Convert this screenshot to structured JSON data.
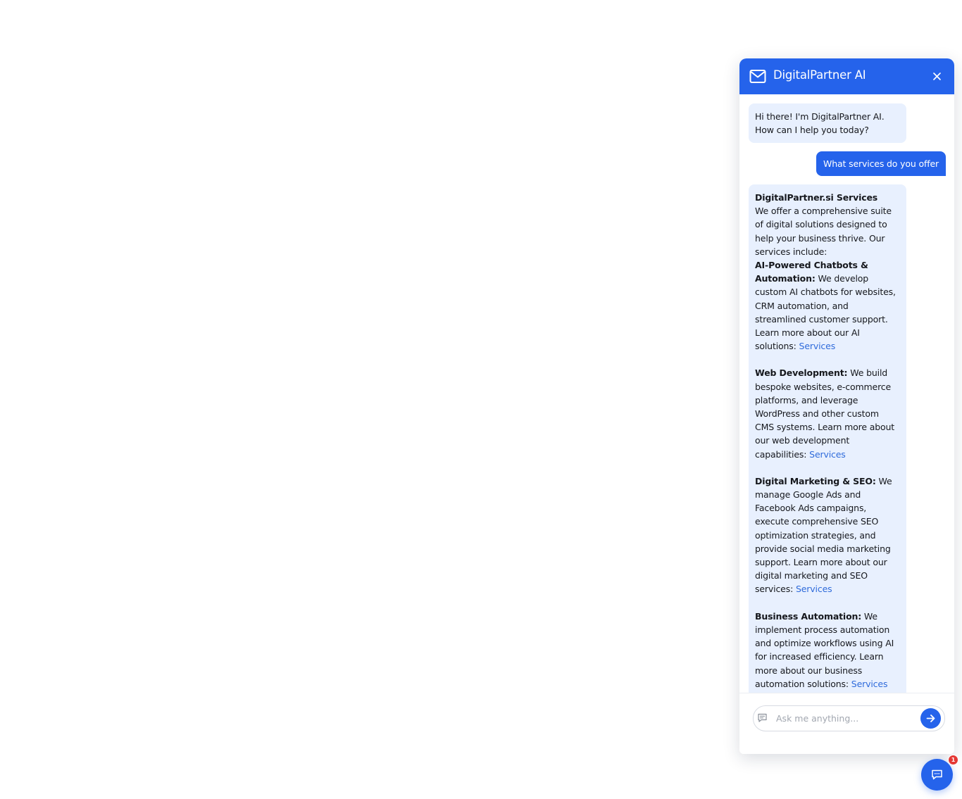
{
  "header": {
    "title": "DigitalPartner AI",
    "icon": "mail-icon",
    "close_icon": "close-icon",
    "color": "#2563eb"
  },
  "messages": [
    {
      "role": "bot",
      "text": "Hi there! I'm DigitalPartner AI. How can I help you today?"
    },
    {
      "role": "user",
      "text": "What services do you offer"
    },
    {
      "role": "bot",
      "heading": "DigitalPartner.si Services",
      "intro": "We offer a comprehensive suite of digital solutions designed to help your business thrive. Our services include:",
      "sections": [
        {
          "title": "AI-Powered Chatbots & Automation:",
          "body": " We develop custom AI chatbots for websites, CRM automation, and streamlined customer support. Learn more about our AI solutions: ",
          "link": "Services"
        },
        {
          "title": "Web Development:",
          "body": " We build bespoke websites, e-commerce platforms, and leverage WordPress and other custom CMS systems. Learn more about our web development capabilities: ",
          "link": "Services"
        },
        {
          "title": "Digital Marketing & SEO:",
          "body": " We manage Google Ads and Facebook Ads campaigns, execute comprehensive SEO optimization strategies, and provide social media marketing support. Learn more about our digital marketing and SEO services: ",
          "link": "Services"
        },
        {
          "title": "Business Automation:",
          "body": " We implement process automation and optimize workflows using AI for increased efficiency. Learn more about our business automation solutions: ",
          "link": "Services"
        }
      ]
    }
  ],
  "input": {
    "placeholder": "Ask me anything...",
    "value": ""
  },
  "launcher": {
    "icon": "chat-bubble-icon",
    "badge_count": "1",
    "badge_color": "#e53935"
  }
}
